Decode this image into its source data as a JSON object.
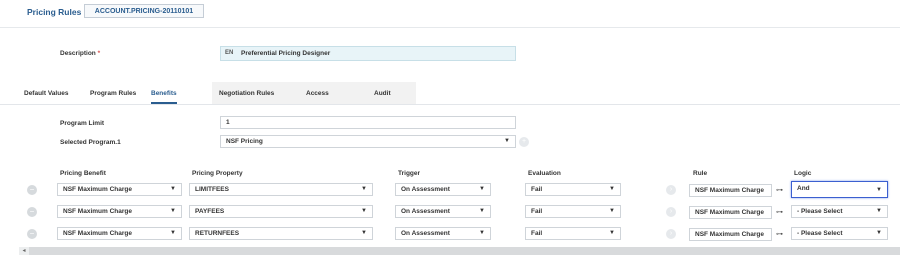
{
  "header": {
    "title": "Pricing Rules",
    "account_code": "ACCOUNT.PRICING-20110101"
  },
  "description": {
    "label": "Description",
    "required_mark": "*",
    "lang": "EN",
    "value": "Preferential Pricing Designer"
  },
  "tabs": [
    {
      "label": "Default Values"
    },
    {
      "label": "Program Rules"
    },
    {
      "label": "Benefits",
      "active": true
    },
    {
      "label": "Negotiation Rules"
    },
    {
      "label": "Access"
    },
    {
      "label": "Audit"
    }
  ],
  "program": {
    "limit_label": "Program Limit",
    "limit_value": "1",
    "selected_label": "Selected Program.1",
    "selected_value": "NSF Pricing"
  },
  "columns": {
    "benefit": "Pricing Benefit",
    "property": "Pricing Property",
    "trigger": "Trigger",
    "evaluation": "Evaluation",
    "rule": "Rule",
    "logic": "Logic"
  },
  "rows": [
    {
      "benefit": "NSF Maximum Charge",
      "property": "LIMITFEES",
      "trigger": "On Assessment",
      "evaluation": "Fail",
      "rule": "NSF Maximum Charge",
      "logic": "And"
    },
    {
      "benefit": "NSF Maximum Charge",
      "property": "PAYFEES",
      "trigger": "On Assessment",
      "evaluation": "Fail",
      "rule": "NSF Maximum Charge",
      "logic": "- Please Select"
    },
    {
      "benefit": "NSF Maximum Charge",
      "property": "RETURNFEES",
      "trigger": "On Assessment",
      "evaluation": "Fail",
      "rule": "NSF Maximum Charge",
      "logic": "- Please Select"
    }
  ],
  "icons": {
    "remove": "minus-circle-icon",
    "caret": "caret-down-icon",
    "link": "link-arrow-icon",
    "add": "plus-circle-icon",
    "scroll_left": "scroll-left-arrow-icon"
  },
  "colors": {
    "accent": "#2a5d8f",
    "focus": "#3b5fd0",
    "description_bg": "#e8f4f8"
  }
}
